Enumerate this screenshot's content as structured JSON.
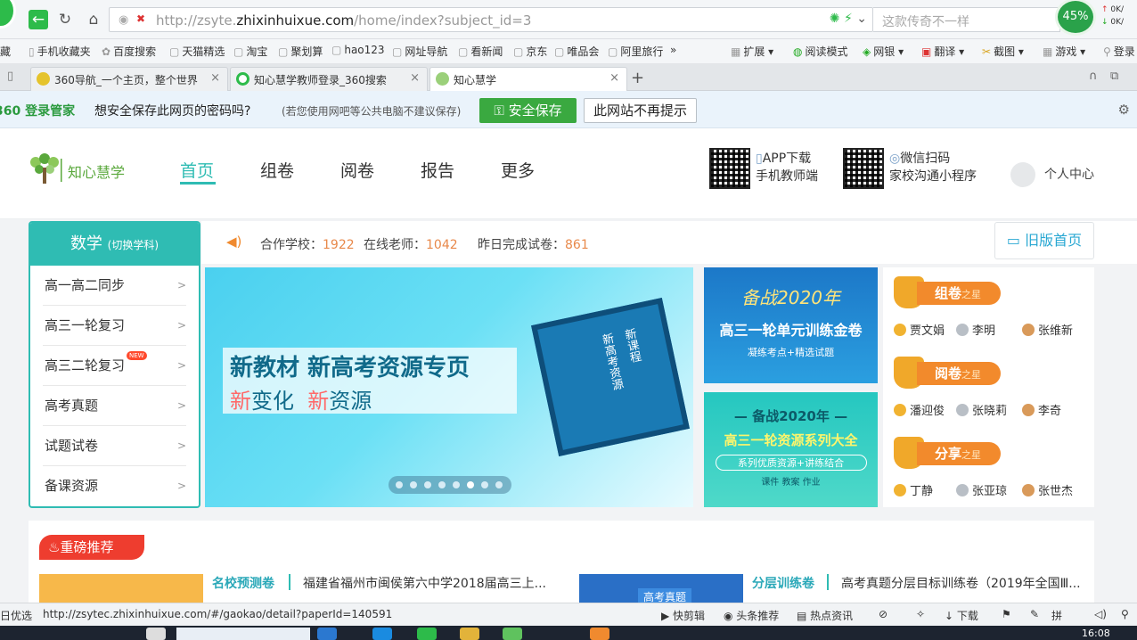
{
  "browser": {
    "url_prefix": "http://zsyte.",
    "url_domain": "zhixinhuixue.com",
    "url_path": "/home/index?subject_id=3",
    "search_placeholder": "这款传奇不一样",
    "speed": "45%",
    "net_up": "0K/",
    "net_down": "0K/"
  },
  "bookmarks": [
    {
      "label": "藏"
    },
    {
      "label": "手机收藏夹"
    },
    {
      "label": "百度搜索"
    },
    {
      "label": "天猫精选"
    },
    {
      "label": "淘宝"
    },
    {
      "label": "聚划算"
    },
    {
      "label": "hao123"
    },
    {
      "label": "网址导航"
    },
    {
      "label": "看新闻"
    },
    {
      "label": "京东"
    },
    {
      "label": "唯品会"
    },
    {
      "label": "阿里旅行"
    },
    {
      "label": "»"
    }
  ],
  "toolbar_right": [
    {
      "label": "扩展"
    },
    {
      "label": "阅读模式"
    },
    {
      "label": "网银"
    },
    {
      "label": "翻译"
    },
    {
      "label": "截图"
    },
    {
      "label": "游戏"
    },
    {
      "label": "登录"
    }
  ],
  "tabs": [
    {
      "label": "360导航_一个主页，整个世界"
    },
    {
      "label": "知心慧学教师登录_360搜索"
    },
    {
      "label": "知心慧学"
    }
  ],
  "password_bar": {
    "brand": "360 登录管家",
    "question": "想安全保存此网页的密码吗?",
    "note": "(若您使用网吧等公共电脑不建议保存)",
    "save_label": "安全保存",
    "never_label": "此网站不再提示"
  },
  "site": {
    "logo_text": "知心慧学",
    "nav": [
      "首页",
      "组卷",
      "阅卷",
      "报告",
      "更多"
    ],
    "app_line1": "APP下载",
    "app_line2": "手机教师端",
    "wx_line1": "微信扫码",
    "wx_line2": "家校沟通小程序",
    "user_center": "个人中心"
  },
  "stats": {
    "schools_label": "合作学校：",
    "schools_value": "1922",
    "teachers_label": "在线老师：",
    "teachers_value": "1042",
    "papers_label": "昨日完成试卷：",
    "papers_value": "861",
    "old_home": "旧版首页"
  },
  "subject": {
    "title": "数学",
    "switch": "(切换学科)",
    "items": [
      "高一高二同步",
      "高三一轮复习",
      "高三二轮复习",
      "高考真题",
      "试题试卷",
      "备课资源"
    ],
    "new_badge": "NEW"
  },
  "banner": {
    "title": "新教材 新高考资源专页",
    "sub_prefix1": "新",
    "sub_word1": "变化",
    "sub_prefix2": "新",
    "sub_word2": "资源",
    "screen_text1": "新课程",
    "screen_text2": "新高考资源",
    "dot_count": 8,
    "active_dot": 6
  },
  "cards": {
    "a_line1": "备战2020年",
    "a_line2": "高三一轮单元训练金卷",
    "a_line3": "凝练考点+精选试题",
    "b_line1": "— 备战2020年 —",
    "b_line2": "高三一轮资源系列大全",
    "b_line3": "系列优质资源+讲练结合",
    "b_line4": "课件   教案   作业"
  },
  "stars": [
    {
      "title": "组卷",
      "suffix": "之星",
      "names": [
        "贾文娟",
        "李明",
        "张维新"
      ]
    },
    {
      "title": "阅卷",
      "suffix": "之星",
      "names": [
        "潘迎俊",
        "张晓莉",
        "李奇"
      ]
    },
    {
      "title": "分享",
      "suffix": "之星",
      "names": [
        "丁静",
        "张亚琼",
        "张世杰"
      ]
    }
  ],
  "recommend": {
    "badge": "重磅推荐",
    "img1_text": "",
    "cat1": "名校预测卷",
    "title1": "福建省福州市闽侯第六中学2018届高三上...",
    "img2_text": "高考真题",
    "cat2": "分层训练卷",
    "title2": "高考真题分层目标训练卷（2019年全国Ⅲ..."
  },
  "status": {
    "left": "日优选",
    "url": "http://zsytec.zhixinhuixue.com/#/gaokao/detail?paperId=140591",
    "items": [
      "快剪辑",
      "头条推荐",
      "热点资讯",
      "下载",
      "拼"
    ]
  },
  "taskbar": {
    "time": "16:08"
  },
  "colors": {
    "brand_teal": "#2fbcb3",
    "stat_orange": "#e8894b",
    "save_green": "#3aa940",
    "badge_red": "#ee3d2f"
  }
}
